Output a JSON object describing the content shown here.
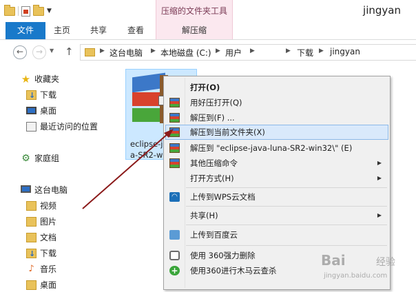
{
  "window": {
    "title": "jingyan",
    "contextual_tab_group": "压缩的文件夹工具"
  },
  "ribbon": {
    "tabs": [
      {
        "label": "文件"
      },
      {
        "label": "主页"
      },
      {
        "label": "共享"
      },
      {
        "label": "查看"
      },
      {
        "label": "解压缩"
      }
    ]
  },
  "address": {
    "breadcrumbs": [
      "这台电脑",
      "本地磁盘 (C:)",
      "用户",
      "下载",
      "jingyan"
    ]
  },
  "nav_pane": {
    "favorites": {
      "label": "收藏夹",
      "items": [
        "下载",
        "桌面",
        "最近访问的位置"
      ]
    },
    "homegroup": {
      "label": "家庭组"
    },
    "this_pc": {
      "label": "这台电脑",
      "items": [
        "视频",
        "图片",
        "文档",
        "下载",
        "音乐",
        "桌面"
      ]
    }
  },
  "file": {
    "name_line1": "eclipse-j",
    "name_line2": "a-SR2-wi"
  },
  "context_menu": {
    "items": [
      {
        "label": "打开(O)",
        "bold": true
      },
      {
        "label": "用好压打开(Q)"
      },
      {
        "label": "解压到(F) ..."
      },
      {
        "label": "解压到当前文件夹(X)",
        "highlighted": true
      },
      {
        "label": "解压到 \"eclipse-java-luna-SR2-win32\\\" (E)"
      },
      {
        "label": "其他压缩命令",
        "submenu": true
      },
      {
        "label": "打开方式(H)",
        "submenu": true
      },
      {
        "label": "上传到WPS云文档"
      },
      {
        "label": "共享(H)",
        "submenu": true
      },
      {
        "label": "上传到百度云"
      },
      {
        "label": "使用 360强力删除"
      },
      {
        "label": "使用360进行木马云查杀"
      }
    ]
  },
  "watermark": {
    "brand": "Bai",
    "brand_suffix": "经验",
    "url": "jingyan.baidu.com"
  }
}
